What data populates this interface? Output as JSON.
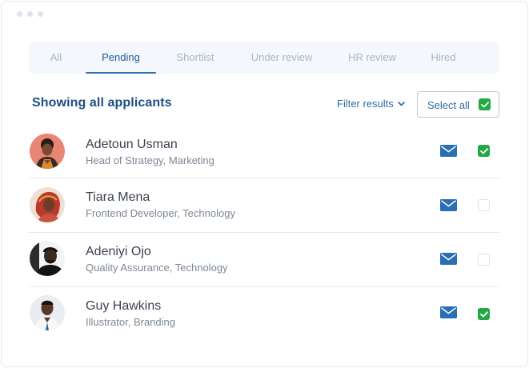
{
  "tabs": [
    {
      "label": "All",
      "active": false
    },
    {
      "label": "Pending",
      "active": true
    },
    {
      "label": "Shortlist",
      "active": false
    },
    {
      "label": "Under review",
      "active": false
    },
    {
      "label": "HR review",
      "active": false
    },
    {
      "label": "Hired",
      "active": false
    }
  ],
  "heading": "Showing all applicants",
  "filter_label": "Filter results",
  "select_all": {
    "label": "Select all",
    "checked": true
  },
  "applicants": [
    {
      "name": "Adetoun Usman",
      "role": "Head of Strategy, Marketing",
      "checked": true
    },
    {
      "name": "Tiara Mena",
      "role": "Frontend Developer, Technology",
      "checked": false
    },
    {
      "name": "Adeniyi Ojo",
      "role": "Quality Assurance, Technology",
      "checked": false
    },
    {
      "name": "Guy Hawkins",
      "role": "Illustrator, Branding",
      "checked": true
    }
  ],
  "colors": {
    "accent": "#2a6fb3",
    "heading": "#1e4f82",
    "check": "#22a845",
    "mail_icon": "#2a6fb3"
  },
  "icons": {
    "mail": "mail-icon",
    "check": "check-icon",
    "chevron": "chevron-down-icon"
  }
}
